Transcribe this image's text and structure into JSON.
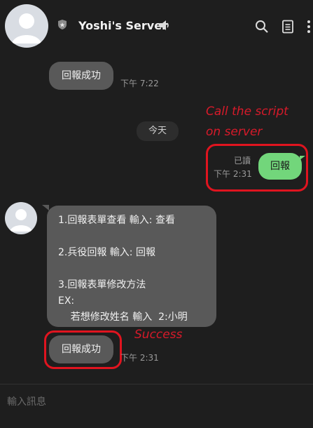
{
  "header": {
    "title": "Yoshi's Server",
    "icons": [
      "avatar",
      "shield-icon",
      "speaker-icon",
      "search-icon",
      "notes-icon",
      "more-vert-icon"
    ]
  },
  "messages": {
    "first": {
      "text": "回報成功",
      "time": "下午 7:22"
    },
    "date_divider": "今天",
    "sent": {
      "text": "回報",
      "read": "已讀",
      "time": "下午 2:31"
    },
    "menu_lines": [
      "1.回報表單查看 輸入: 查看",
      "",
      "2.兵役回報 輸入: 回報",
      "",
      "3.回報表單修改方法",
      "EX:",
      "    若想修改姓名 輸入  2:小明"
    ],
    "success": {
      "text": "回報成功",
      "time": "下午 2:31"
    }
  },
  "annotations": {
    "call_line1": "Call the script",
    "call_line2": "on server",
    "success": "Success"
  },
  "input": {
    "placeholder": "輸入訊息"
  },
  "colors": {
    "background": "#1e1e1e",
    "bubble": "#595959",
    "sent_bubble": "#72d67b",
    "annotation": "#d81a2a"
  }
}
